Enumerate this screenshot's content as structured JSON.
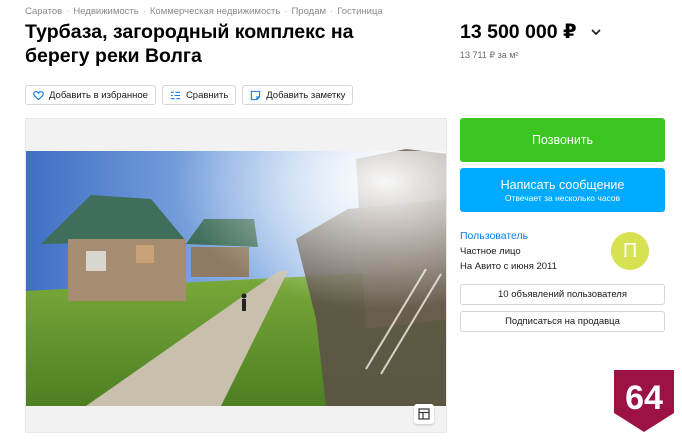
{
  "breadcrumbs": [
    "Саратов",
    "Недвижимость",
    "Коммерческая недвижимость",
    "Продам",
    "Гостиница"
  ],
  "title": "Турбаза, загородный комплекс на берегу реки Волга",
  "price": {
    "value": "13 500 000 ₽",
    "per_m": "13 711 ₽ за м²"
  },
  "actions": {
    "favorite": "Добавить в избранное",
    "compare": "Сравнить",
    "note": "Добавить заметку"
  },
  "contact": {
    "call": "Позвонить",
    "message": "Написать сообщение",
    "message_sub": "Отвечает за несколько часов"
  },
  "seller": {
    "name": "Пользователь",
    "type": "Частное лицо",
    "since": "На Авито с июня 2011",
    "avatar_letter": "П",
    "avatar_color": "#d6e251",
    "listings_btn": "10 объявлений пользователя",
    "subscribe_btn": "Подписаться на продавца"
  },
  "badge": {
    "text": "64",
    "color": "#9c1245"
  },
  "colors": {
    "call": "#3cc624",
    "message": "#00aaff",
    "link": "#0a7ce5"
  }
}
